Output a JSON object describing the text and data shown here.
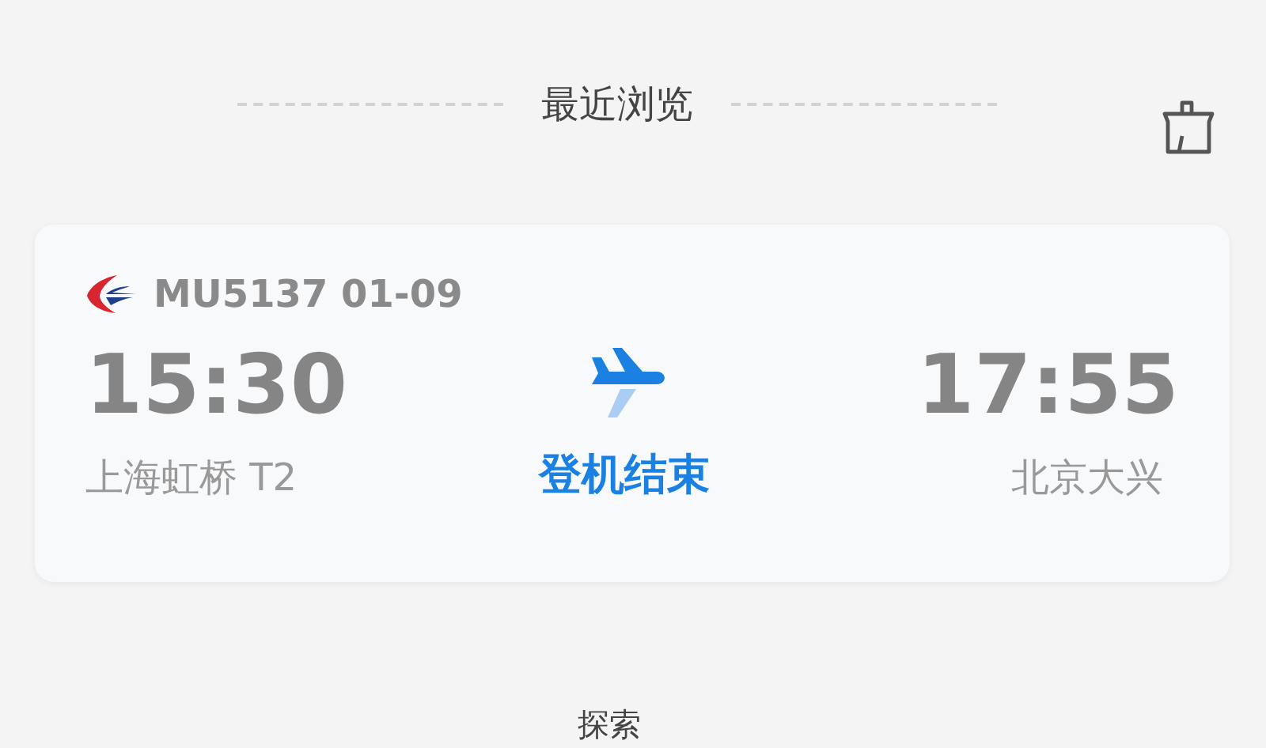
{
  "section_header": {
    "title": "最近浏览"
  },
  "recent_flight": {
    "flight": "MU5137 01-09",
    "departure": {
      "time": "15:30",
      "airport": "上海虹桥 T2"
    },
    "status": "登机结束",
    "arrival": {
      "time": "17:55",
      "airport": "北京大兴"
    }
  },
  "next_section": {
    "title": "探索"
  }
}
